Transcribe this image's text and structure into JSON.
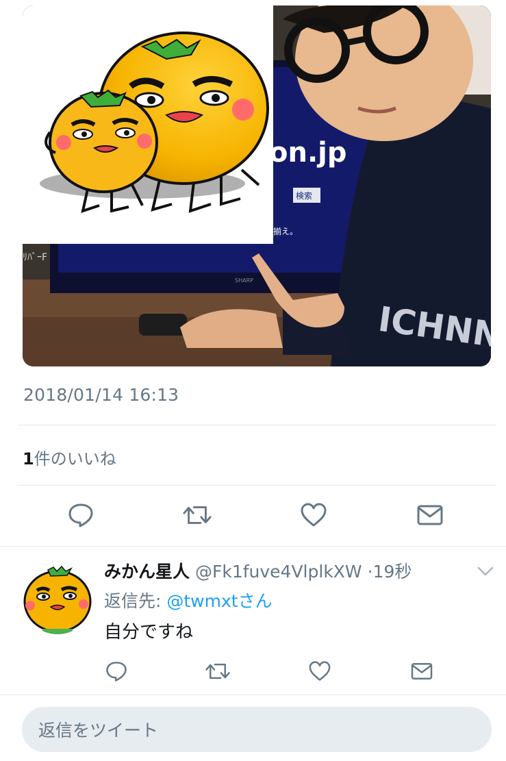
{
  "tweet": {
    "timestamp": "2018/01/14 16:13",
    "likes_count": "1",
    "likes_suffix": "件のいいね",
    "media": {
      "monitor_logo_text": "on.jp",
      "search_button_text": "検索",
      "monitor_small_text": "揃え。",
      "brand_text": "SHARP",
      "left_edge_text": "ﾘﾊﾟｰF",
      "shirt_text": "ICHNN"
    },
    "actions": [
      "reply-icon",
      "retweet-icon",
      "like-icon",
      "message-icon"
    ]
  },
  "reply": {
    "display_name": "みかん星人",
    "handle": "@Fk1fuve4VlplkXW",
    "separator": "·",
    "time": "19秒",
    "replying_prefix": "返信先: ",
    "replying_mention": "@twmxtさん",
    "text": "自分ですね",
    "actions": [
      "reply-icon",
      "retweet-icon",
      "like-icon",
      "message-icon"
    ]
  },
  "compose": {
    "placeholder": "返信をツイート"
  },
  "colors": {
    "icon": "#657786",
    "link": "#1da1f2",
    "divider": "#e1e8ed",
    "compose_bg": "#e6ecf0",
    "mikan_orange": "#f6b400"
  }
}
